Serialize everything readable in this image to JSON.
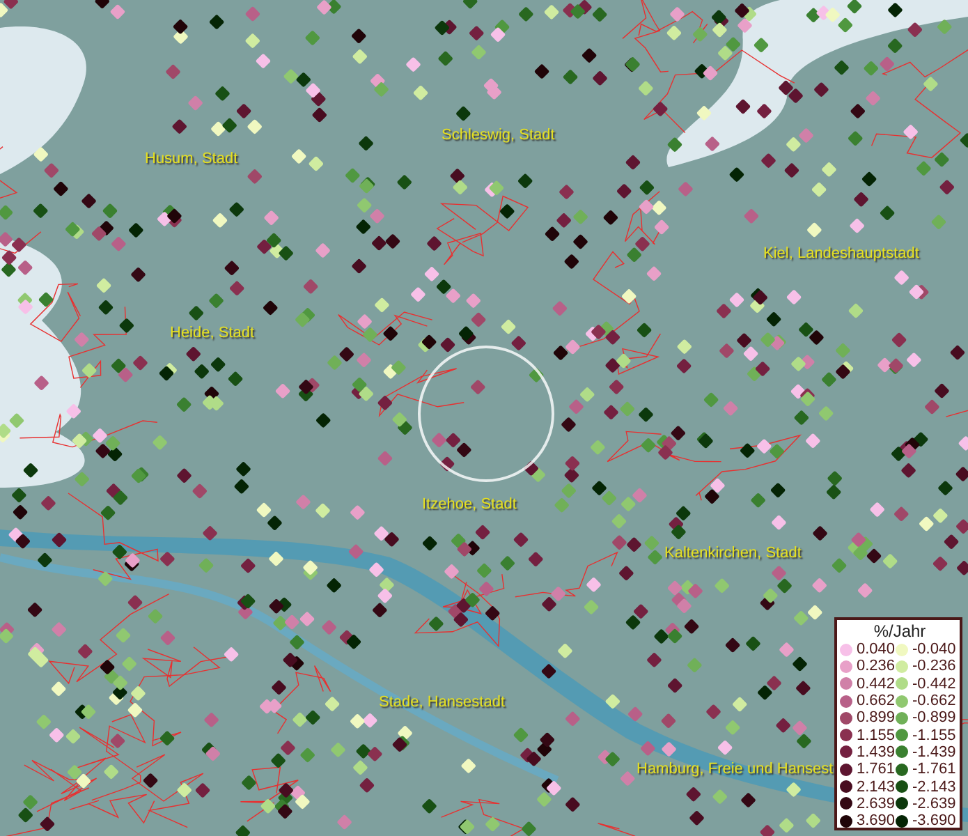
{
  "map": {
    "place_labels": [
      {
        "text": "Husum, Stadt"
      },
      {
        "text": "Schleswig, Stadt"
      },
      {
        "text": "Kiel, Landeshauptstadt"
      },
      {
        "text": "Heide, Stadt"
      },
      {
        "text": "Itzehoe, Stadt"
      },
      {
        "text": "Kaltenkirchen, Stadt"
      },
      {
        "text": "Stade, Hansestadt"
      },
      {
        "text": "Hamburg, Freie und Hansest"
      }
    ]
  },
  "legend": {
    "title": "%/Jahr",
    "entries": [
      {
        "label": "0.040",
        "color": "#f7c0e8"
      },
      {
        "label": "-0.040",
        "color": "#f0f8c0"
      },
      {
        "label": "0.236",
        "color": "#e8a0c8"
      },
      {
        "label": "-0.236",
        "color": "#d0eca0"
      },
      {
        "label": "0.442",
        "color": "#d080a8"
      },
      {
        "label": "-0.442",
        "color": "#b0dc88"
      },
      {
        "label": "0.662",
        "color": "#b86088"
      },
      {
        "label": "-0.662",
        "color": "#90c870"
      },
      {
        "label": "0.899",
        "color": "#a04868"
      },
      {
        "label": "-0.899",
        "color": "#70b058"
      },
      {
        "label": "1.155",
        "color": "#8a3050"
      },
      {
        "label": "-1.155",
        "color": "#509840"
      },
      {
        "label": "1.439",
        "color": "#742040"
      },
      {
        "label": "-1.439",
        "color": "#3a8030"
      },
      {
        "label": "1.761",
        "color": "#5e1530"
      },
      {
        "label": "-1.761",
        "color": "#286820"
      },
      {
        "label": "2.143",
        "color": "#480c20"
      },
      {
        "label": "-2.143",
        "color": "#185014"
      },
      {
        "label": "2.639",
        "color": "#340814"
      },
      {
        "label": "-2.639",
        "color": "#0c380c"
      },
      {
        "label": "3.690",
        "color": "#200408"
      },
      {
        "label": "-3.690",
        "color": "#042404"
      }
    ]
  }
}
